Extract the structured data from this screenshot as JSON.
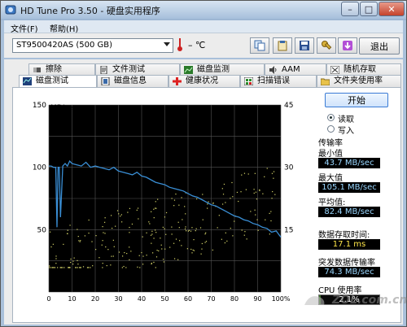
{
  "window": {
    "title": "HD Tune Pro 3.50 - 硬盘实用程序",
    "minimize": "–",
    "maximize": "□",
    "close": "✕"
  },
  "menu": {
    "file": "文件(F)",
    "help": "帮助(H)"
  },
  "toolbar": {
    "drive": "ST9500420AS (500 GB)",
    "temperature": "– ℃",
    "exit": "退出"
  },
  "tabs_top": [
    {
      "label": "擦除",
      "icon": "eraser-icon"
    },
    {
      "label": "文件测试",
      "icon": "file-test-icon"
    },
    {
      "label": "磁盘监测",
      "icon": "disk-monitor-icon"
    },
    {
      "label": "AAM",
      "icon": "speaker-icon"
    },
    {
      "label": "随机存取",
      "icon": "random-access-icon"
    }
  ],
  "tabs_bottom": [
    {
      "label": "磁盘测试",
      "icon": "benchmark-icon"
    },
    {
      "label": "磁盘信息",
      "icon": "info-icon"
    },
    {
      "label": "健康状况",
      "icon": "health-cross-icon"
    },
    {
      "label": "扫描错误",
      "icon": "scan-icon"
    },
    {
      "label": "文件夹使用率",
      "icon": "folder-icon"
    }
  ],
  "controls": {
    "start": "开始",
    "read": "读取",
    "write": "写入"
  },
  "stats": {
    "transfer_rate": "传输率",
    "min_label": "最小值",
    "min_value": "43.7 MB/sec",
    "max_label": "最大值",
    "max_value": "105.1 MB/sec",
    "avg_label": "平均值:",
    "avg_value": "82.4 MB/sec",
    "access_label": "数据存取时间:",
    "access_value": "17.1 ms",
    "burst_label": "突发数据传输率",
    "burst_value": "74.3 MB/sec",
    "cpu_label": "CPU 使用率",
    "cpu_value": "2.1%",
    "cpu_fraction": 0.021
  },
  "watermark": "ZOL.com.cn",
  "chart_data": {
    "type": "line",
    "ylabel_left": "MB/sec",
    "ylabel_right": "ms",
    "yticks_left": [
      "150",
      "100",
      "50"
    ],
    "yticks_right": [
      "45",
      "30",
      "15"
    ],
    "xticks": [
      "0",
      "10",
      "20",
      "30",
      "40",
      "50",
      "60",
      "70",
      "80",
      "90",
      "100%"
    ],
    "ylim_left": [
      0,
      150
    ],
    "ylim_right": [
      0,
      45
    ],
    "grid": true,
    "series": [
      {
        "color": "#3a8fd6",
        "x": [
          0,
          1,
          2,
          3,
          3.5,
          4,
          4.5,
          5,
          6,
          7,
          8,
          9,
          10,
          12,
          14,
          16,
          18,
          20,
          22,
          24,
          26,
          28,
          30,
          32,
          34,
          36,
          38,
          40,
          42,
          44,
          46,
          48,
          50,
          52,
          54,
          56,
          58,
          60,
          62,
          64,
          66,
          68,
          70,
          72,
          74,
          76,
          78,
          80,
          82,
          84,
          86,
          88,
          90,
          92,
          94,
          96,
          98,
          100
        ],
        "y": [
          101,
          101,
          100,
          100,
          52,
          100,
          100,
          60,
          101,
          103,
          101,
          105,
          103,
          102,
          101,
          104,
          100,
          101,
          100,
          99,
          98,
          100,
          97,
          96,
          95,
          94,
          96,
          93,
          92,
          90,
          88,
          87,
          86,
          84,
          83,
          82,
          81,
          79,
          77,
          76,
          74,
          72,
          70,
          69,
          67,
          65,
          63,
          61,
          60,
          58,
          57,
          55,
          54,
          52,
          51,
          48,
          49,
          44
        ]
      }
    ],
    "scatter_color": "#d7d66a"
  }
}
